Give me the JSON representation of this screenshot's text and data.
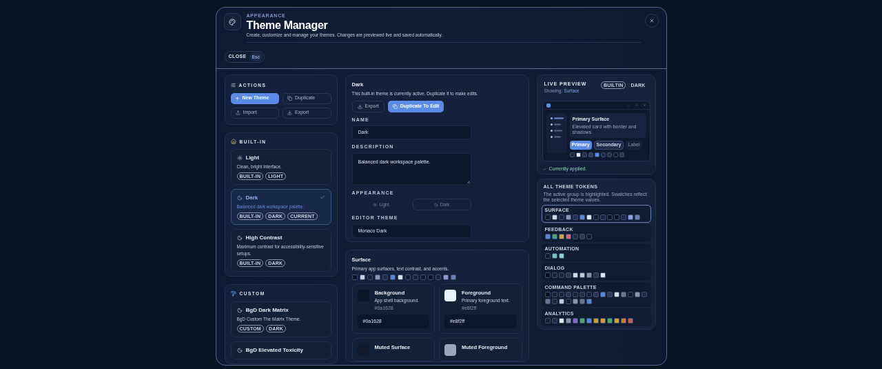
{
  "header": {
    "eyebrow": "APPEARANCE",
    "title": "Theme Manager",
    "subtitle": "Create, customize and manage your themes. Changes are previewed live and saved automatically.",
    "close_label": "CLOSE",
    "close_key": "Esc"
  },
  "actions": {
    "title": "ACTIONS",
    "buttons": [
      {
        "label": "New Theme",
        "kind": "new",
        "primary": true
      },
      {
        "label": "Duplicate",
        "kind": "duplicate",
        "primary": false
      },
      {
        "label": "Import",
        "kind": "import",
        "primary": false
      },
      {
        "label": "Export",
        "kind": "export",
        "primary": false
      }
    ]
  },
  "built_in": {
    "title": "BUILT-IN",
    "themes": [
      {
        "name": "Light",
        "description": "Clean, bright interface.",
        "kind": "light",
        "tags": [
          "BUILT-IN",
          "LIGHT"
        ],
        "selected": false
      },
      {
        "name": "Dark",
        "description": "Balanced dark workspace palette.",
        "kind": "dark",
        "tags": [
          "BUILT-IN",
          "DARK",
          "CURRENT"
        ],
        "selected": true
      },
      {
        "name": "High Contrast",
        "description": "Maximum contrast for accessibility-sensitive setups.",
        "kind": "dark",
        "tags": [
          "BUILT-IN",
          "DARK"
        ],
        "selected": false
      }
    ]
  },
  "custom": {
    "title": "CUSTOM",
    "themes": [
      {
        "name": "BgD Dark Matrix",
        "description": "BgD Custom The Matrix Theme.",
        "kind": "dark",
        "tags": [
          "CUSTOM",
          "DARK"
        ],
        "selected": false
      },
      {
        "name": "BgD Elevated Toxicity",
        "kind": "dark",
        "selected": false
      }
    ]
  },
  "editor": {
    "title": "Dark",
    "note": "This built-in theme is currently active. Duplicate it to make edits.",
    "buttons": [
      {
        "label": "Export",
        "kind": "export",
        "primary": false
      },
      {
        "label": "Duplicate To Edit",
        "kind": "duplicate",
        "primary": true
      }
    ],
    "name_label": "NAME",
    "name_value": "Dark",
    "description_label": "DESCRIPTION",
    "description_value": "Balanced dark workspace palette.",
    "appearance_label": "APPEARANCE",
    "appearance_disabled": true,
    "appearance_options": [
      {
        "label": "Light",
        "kind": "light",
        "selected": false
      },
      {
        "label": "Dark",
        "kind": "dark",
        "selected": true
      }
    ],
    "editor_theme_label": "EDITOR THEME",
    "editor_theme_value": "Monaco Dark"
  },
  "group": {
    "title": "Surface",
    "description": "Primary app surfaces, text contrast, and accents.",
    "swatches": [
      {
        "color": "#0a1628"
      },
      {
        "color": "#c8d3e6"
      },
      {
        "color": "#14213a"
      },
      {
        "color": "#8a97b0"
      },
      {
        "color": "#1e2c48"
      },
      {
        "color": "#5b86d6"
      },
      {
        "color": "#d8dee9"
      },
      {
        "color": "#101c30"
      },
      {
        "color": "#18243a"
      },
      {
        "color": "#0f1a2e"
      },
      {
        "color": "#0a1424"
      },
      {
        "color": "#17233a"
      },
      {
        "color": "#8d9ec8"
      },
      {
        "color": "#6b7fb8"
      }
    ],
    "tokens": [
      {
        "name": "Background",
        "description": "App shell background.",
        "hex": "#0a1628",
        "value": "#0a1628",
        "color": "#0a1628"
      },
      {
        "name": "Foreground",
        "description": "Primary foreground text.",
        "hex": "#e8f2ff",
        "value": "#e8f2ff",
        "color": "#e8f2ff"
      },
      {
        "name": "Muted Surface",
        "color": "#101a2c"
      },
      {
        "name": "Muted Foreground",
        "color": "#9aa6bd"
      }
    ]
  },
  "preview": {
    "title": "LIVE PREVIEW",
    "showing_label": "Showing:",
    "showing_value": "Surface",
    "badges": [
      {
        "label": "BUILTIN",
        "outlined": true
      },
      {
        "label": "DARK",
        "outlined": false
      }
    ],
    "card_title": "Primary Surface",
    "card_text": "Elevated card with border and shadows",
    "buttons": [
      {
        "label": "Primary",
        "kind": "primary"
      },
      {
        "label": "Secondary",
        "kind": "secondary"
      },
      {
        "label": "Label",
        "kind": "label"
      }
    ],
    "swatches": [
      {
        "color": "#1c2838"
      },
      {
        "color": "#f4f6fa"
      },
      {
        "color": "#22304a"
      },
      {
        "color": "#2e3d5c"
      },
      {
        "color": "#5b8fea"
      },
      {
        "color": "#1e2c48"
      },
      {
        "color": "#22304a"
      },
      {
        "color": "#111a2c"
      },
      {
        "color": "#2a3850"
      }
    ],
    "status": "Currently applied."
  },
  "tokens_panel": {
    "title": "ALL THEME TOKENS",
    "description": "The active group is highlighted. Swatches reflect the selected theme values.",
    "groups": [
      {
        "name": "SURFACE",
        "selected": true,
        "swatches": [
          {
            "color": "#0f1a2e"
          },
          {
            "color": "#d0d8e6"
          },
          {
            "color": "#16223a"
          },
          {
            "color": "#8a94a8"
          },
          {
            "color": "#233150"
          },
          {
            "color": "#5b86d6"
          },
          {
            "color": "#e0e6ef"
          },
          {
            "color": "#111c30"
          },
          {
            "color": "#172640"
          },
          {
            "color": "#0c1628"
          },
          {
            "color": "#0a1322"
          },
          {
            "color": "#1b2a44"
          },
          {
            "color": "#8c9ee0"
          },
          {
            "color": "#6b80b0"
          }
        ]
      },
      {
        "name": "FEEDBACK",
        "selected": false,
        "swatches": [
          {
            "color": "#5b86d6"
          },
          {
            "color": "#4fa37a"
          },
          {
            "color": "#c9a640"
          },
          {
            "color": "#d06a78"
          },
          {
            "color": "#1e2c48"
          },
          {
            "color": "#2a3850"
          },
          {
            "color": "#111c30"
          }
        ]
      },
      {
        "name": "AUTOMATION",
        "selected": false,
        "swatches": [
          {
            "color": "#101c30"
          },
          {
            "color": "#6cc4c0"
          },
          {
            "color": "#8ecfd2"
          }
        ]
      },
      {
        "name": "DIALOG",
        "selected": false,
        "swatches": [
          {
            "color": "#070f1c"
          },
          {
            "color": "#1a2333"
          },
          {
            "color": "#1c2535"
          },
          {
            "color": "#2a3550"
          },
          {
            "color": "#d0d8e6"
          },
          {
            "color": "#c0c8d6"
          },
          {
            "color": "#8a94a8"
          },
          {
            "color": "#2a3550"
          },
          {
            "color": "#e0e6ef"
          }
        ]
      },
      {
        "name": "COMMAND PALETTE",
        "selected": false,
        "swatches": [
          {
            "color": "#070f1c"
          },
          {
            "color": "#1a2333"
          },
          {
            "color": "#1c2535"
          },
          {
            "color": "#2a3550"
          },
          {
            "color": "#1a2438"
          },
          {
            "color": "#243148"
          },
          {
            "color": "#16213a"
          },
          {
            "color": "#2a3550"
          },
          {
            "color": "#5b86d6"
          },
          {
            "color": "#2a3a58"
          },
          {
            "color": "#d8dee9"
          },
          {
            "color": "#6b7690"
          },
          {
            "color": "#111c30"
          },
          {
            "color": "#8a94a8"
          },
          {
            "color": "#1e2c48"
          },
          {
            "color": "#6b7690"
          },
          {
            "color": "#1c2838"
          },
          {
            "color": "#c0c8d6"
          },
          {
            "color": "#111c30"
          },
          {
            "color": "#8a94a8"
          },
          {
            "color": "#6b7690"
          },
          {
            "color": "#5b86d6"
          }
        ]
      },
      {
        "name": "ANALYTICS",
        "selected": false,
        "swatches": [
          {
            "color": "#16223a"
          },
          {
            "color": "#1e2c48"
          },
          {
            "color": "#e0e6ef"
          },
          {
            "color": "#8a94a8"
          },
          {
            "color": "#8a60d0"
          },
          {
            "color": "#4fa860"
          },
          {
            "color": "#5b86d6"
          },
          {
            "color": "#d09a30"
          },
          {
            "color": "#d8a030"
          },
          {
            "color": "#4fa860"
          },
          {
            "color": "#c9a640"
          },
          {
            "color": "#d07a30"
          },
          {
            "color": "#d05a40"
          }
        ]
      }
    ]
  }
}
